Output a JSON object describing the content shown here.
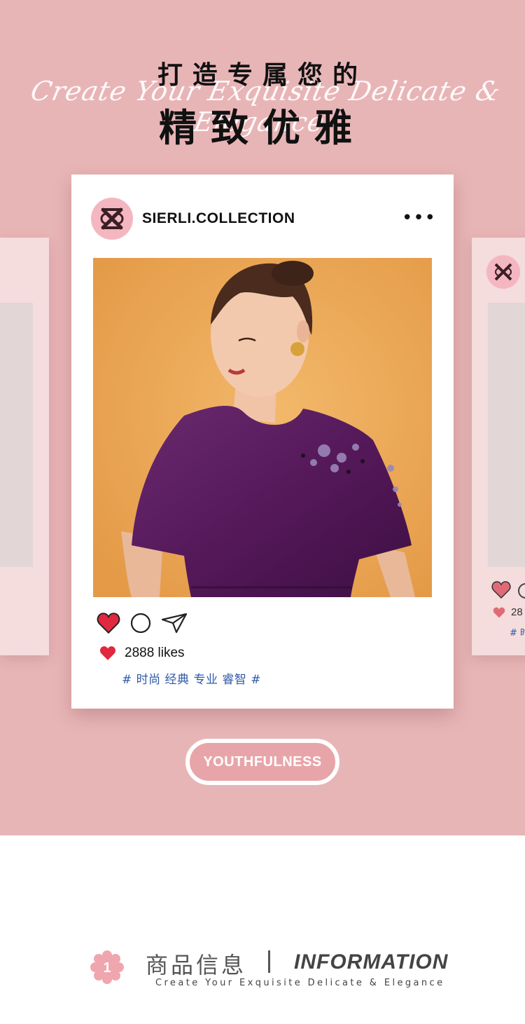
{
  "header": {
    "title_top": "打造专属您的",
    "script_line": "Create Your Exquisite Delicate & Elegance",
    "title_main": "精致优雅"
  },
  "post": {
    "username": "SIERLI.COLLECTION",
    "more_label": "•••",
    "likes": "2888 likes",
    "tags": "# 时尚 经典 专业 睿智 #",
    "icons": [
      "heart-icon",
      "comment-icon",
      "share-icon"
    ]
  },
  "side_card_right": {
    "likes_partial": "28",
    "tag_partial": "# 时"
  },
  "badge": {
    "label": "YOUTHFULNESS"
  },
  "info": {
    "number": "1",
    "title_cn": "商品信息",
    "title_en": "INFORMATION",
    "subtitle": "Create Your Exquisite Delicate & Elegance"
  },
  "colors": {
    "background_pink": "#e8b5b7",
    "card_white": "#ffffff",
    "heart_red": "#e0283f",
    "tag_blue": "#2f5aa8",
    "logo_pink": "#f4b6c0"
  }
}
